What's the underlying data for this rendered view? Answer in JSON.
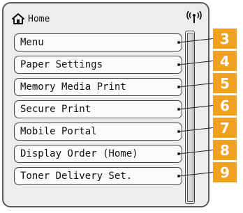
{
  "header": {
    "title": "Home",
    "home_icon": "home-icon",
    "status_icon": "wireless-signal-icon"
  },
  "menu": {
    "items": [
      {
        "label": "Menu",
        "callout": "3"
      },
      {
        "label": "Paper Settings",
        "callout": "4"
      },
      {
        "label": "Memory Media Print",
        "callout": "5"
      },
      {
        "label": "Secure Print",
        "callout": "6"
      },
      {
        "label": "Mobile Portal",
        "callout": "7"
      },
      {
        "label": "Display Order (Home)",
        "callout": "8"
      },
      {
        "label": "Toner Delivery Set.",
        "callout": "9"
      }
    ]
  },
  "colors": {
    "callout_badge": "#f0a21f",
    "panel_background": "#ededed",
    "button_border": "#444444"
  }
}
